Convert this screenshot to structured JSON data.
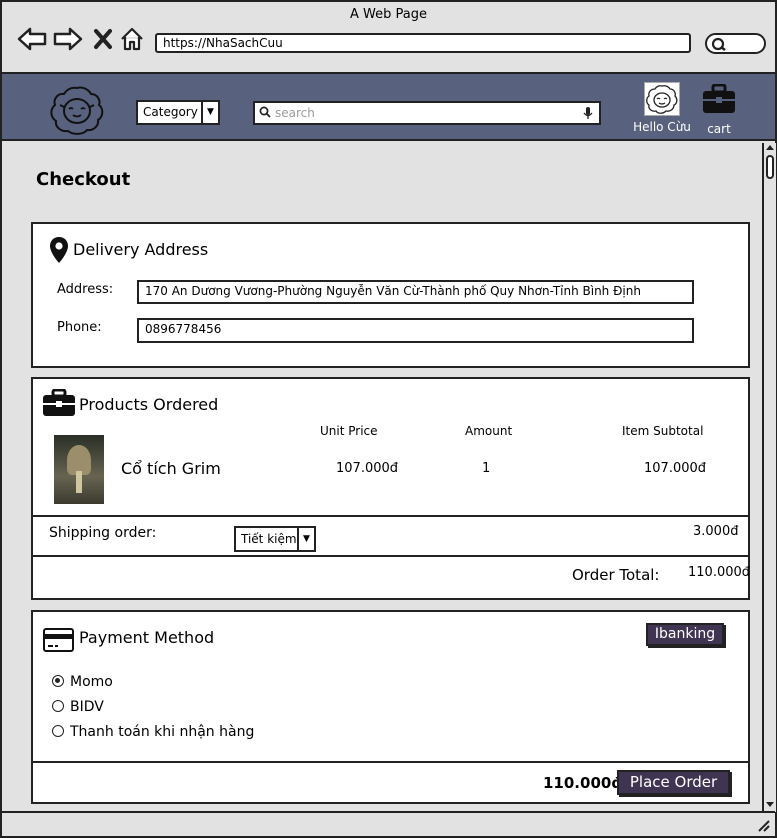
{
  "browser": {
    "window_title": "A Web Page",
    "url": "https://NhaSachCuu"
  },
  "header": {
    "category_label": "Category",
    "search_placeholder": "search",
    "user_greeting": "Hello Cừu",
    "cart_label": "cart",
    "bg_color": "#58627e"
  },
  "checkout": {
    "title": "Checkout",
    "delivery": {
      "heading": "Delivery Address",
      "address_label": "Address:",
      "address_value": "170 An Dương Vương-Phường Nguyễn Văn Cừ-Thành phố Quy Nhơn-Tỉnh Bình Định",
      "phone_label": "Phone:",
      "phone_value": "0896778456"
    },
    "products": {
      "heading": "Products Ordered",
      "columns": {
        "unit_price": "Unit Price",
        "amount": "Amount",
        "item_subtotal": "Item Subtotal"
      },
      "items": [
        {
          "name": "Cổ tích Grim",
          "unit_price": "107.000đ",
          "amount": "1",
          "subtotal": "107.000đ"
        }
      ],
      "shipping_label": "Shipping order:",
      "shipping_option": "Tiết kiệm",
      "shipping_fee": "3.000đ",
      "order_total_label": "Order Total:",
      "order_total_value": "110.000đ"
    },
    "payment": {
      "heading": "Payment Method",
      "ibanking_label": "Ibanking",
      "options": [
        {
          "label": "Momo",
          "selected": true
        },
        {
          "label": "BIDV",
          "selected": false
        },
        {
          "label": "Thanh toán khi nhận hàng",
          "selected": false
        }
      ],
      "total": "110.000đ",
      "place_order_label": "Place Order",
      "button_color": "#3f3452"
    }
  }
}
